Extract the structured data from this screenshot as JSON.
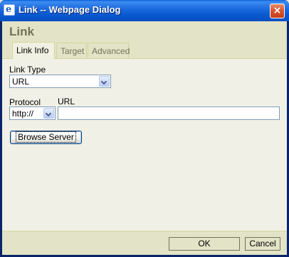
{
  "window": {
    "title": "Link -- Webpage Dialog",
    "close_glyph": "×",
    "icon": "e"
  },
  "dialog": {
    "title": "Link"
  },
  "tabs": [
    {
      "label": "Link Info",
      "active": true
    },
    {
      "label": "Target",
      "active": false
    },
    {
      "label": "Advanced",
      "active": false
    }
  ],
  "link_type": {
    "label": "Link Type",
    "value": "URL"
  },
  "protocol": {
    "label": "Protocol",
    "value": "http://"
  },
  "url": {
    "label": "URL",
    "value": ""
  },
  "browse_button": "Browse Server",
  "footer": {
    "ok_label": "OK",
    "cancel_label": "Cancel"
  },
  "colors": {
    "titlebar": "#0a58d0",
    "header_bg": "#e3e3c7",
    "header_text": "#737357",
    "body_bg": "#f1f0e6"
  }
}
